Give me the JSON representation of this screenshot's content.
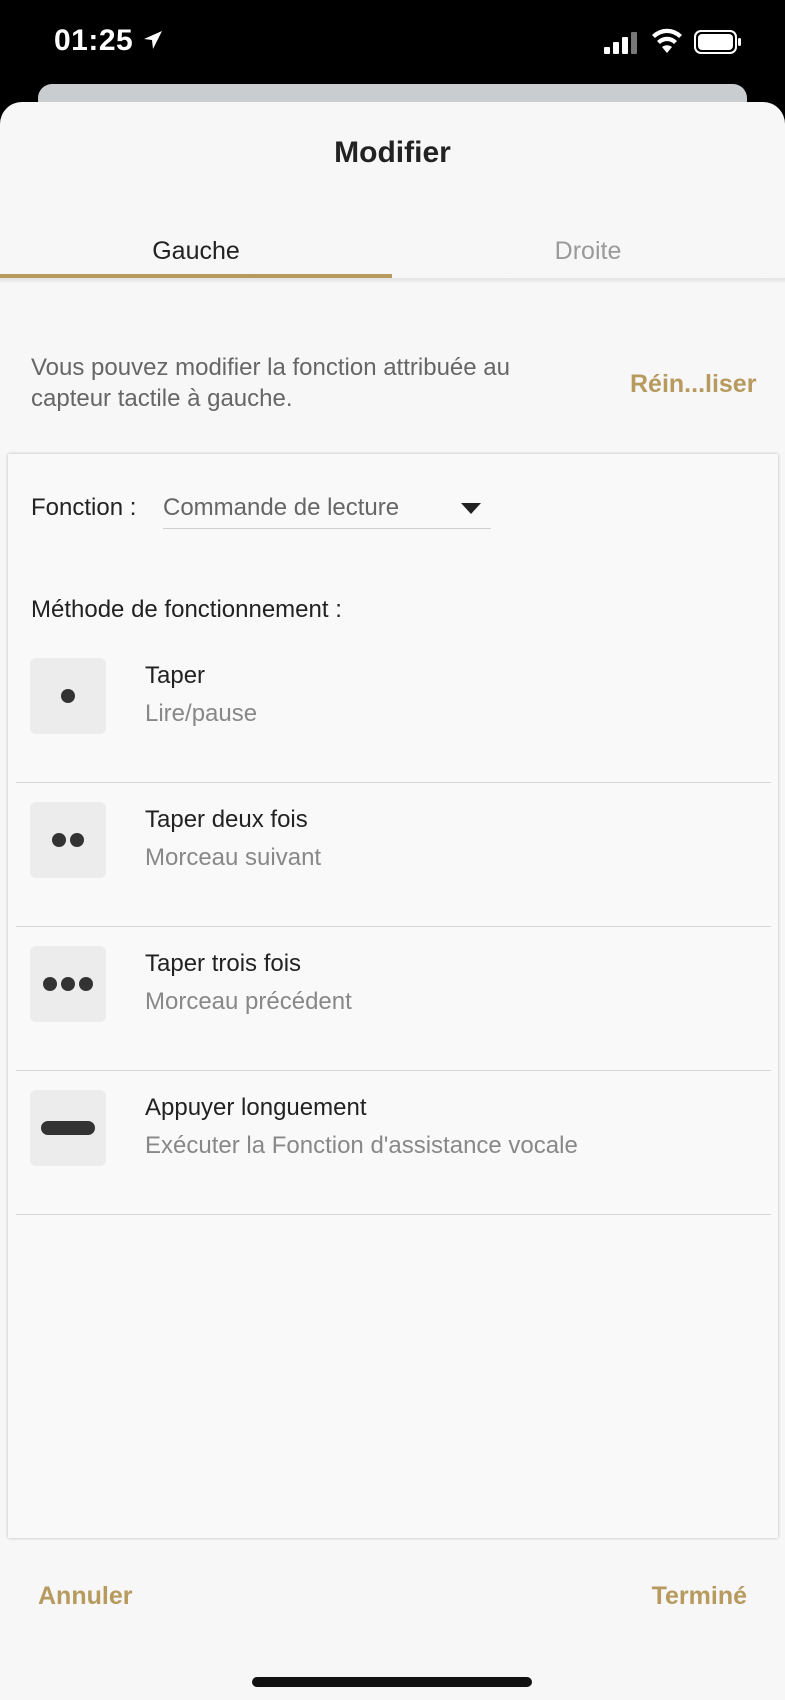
{
  "status_bar": {
    "time": "01:25"
  },
  "sheet": {
    "title": "Modifier",
    "tabs": [
      {
        "label": "Gauche",
        "selected": true
      },
      {
        "label": "Droite",
        "selected": false
      }
    ],
    "description": "Vous pouvez modifier la fonction attribuée au capteur tactile à gauche.",
    "reset_label": "Réin...liser"
  },
  "function": {
    "label": "Fonction :",
    "selected_value": "Commande de lecture"
  },
  "method": {
    "label": "Méthode de fonctionnement :",
    "items": [
      {
        "title": "Taper",
        "subtitle": "Lire/pause",
        "icon": "single-dot-icon"
      },
      {
        "title": "Taper deux fois",
        "subtitle": "Morceau suivant",
        "icon": "two-dots-icon"
      },
      {
        "title": "Taper trois fois",
        "subtitle": "Morceau précédent",
        "icon": "three-dots-icon"
      },
      {
        "title": "Appuyer longuement",
        "subtitle": "Exécuter la Fonction d'assistance vocale",
        "icon": "long-press-bar-icon"
      }
    ]
  },
  "footer": {
    "cancel_label": "Annuler",
    "done_label": "Terminé"
  },
  "colors": {
    "accent": "#b69a5e",
    "background": "#f7f7f7"
  }
}
